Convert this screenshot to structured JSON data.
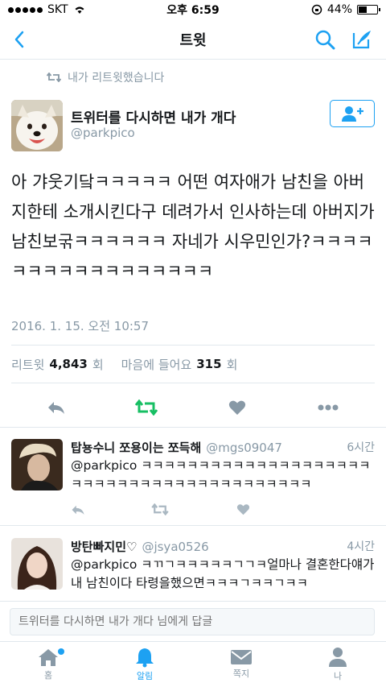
{
  "status_bar": {
    "carrier": "SKT",
    "time": "오후 6:59",
    "battery": "44%"
  },
  "nav": {
    "title": "트윗"
  },
  "retweet_notice": "내가 리트윗했습니다",
  "tweet": {
    "author_name": "트위터를 다시하면 내가 개다",
    "author_handle": "@parkpico",
    "text": "아 갸웃기닼ㅋㅋㅋㅋㅋ 어떤 여자애가 남친을 아버지한테 소개시킨다구 데려가서 인사하는데 아버지가 남친보굮ㅋㅋㅋㅋㅋㅋ 자네가 시우민인가?ㅋㅋㅋㅋㅋㅋㅋㅋㅋㅋㅋㅋㅋㅋㅋㅋㅋ",
    "timestamp": "2016. 1. 15. 오전 10:57",
    "retweets_label": "리트윗",
    "retweets_count": "4,843",
    "likes_label": "마음에 들어요",
    "likes_count": "315",
    "count_unit": "회"
  },
  "replies": [
    {
      "name": "탑뇽수니 쪼용이는 쪼득해",
      "handle": "@mgs09047",
      "time": "6시간",
      "text": "@parkpico ㅋㅋㅋㅋㅋㅋㅋㅋㅋㅋㅋㅋㅋㅋㅋㅋㅋㅋㅋㅋㅋㅋㅋㅋㅋㅋㅋㅋㅋㅋㅋㅋㅋㅋㅋㅋㅋㅋㅋㅋㅋ"
    },
    {
      "name": "방탄빠지민♡",
      "handle": "@jsya0526",
      "time": "4시간",
      "text": "@parkpico ㅋㄲㄱㅋㅋㅋㅋㅋㄱㄱㅋ얼마나 결혼한다얘가 내 남친이다 타령을했으면ㅋㅋㅋㄱㅋㅋㄱㅋㅋ"
    }
  ],
  "reply_box": {
    "placeholder": "트위터를 다시하면 내가 개다 님에게 답글"
  },
  "tabs": [
    {
      "label": "홈",
      "icon": "home-icon"
    },
    {
      "label": "알림",
      "icon": "bell-icon"
    },
    {
      "label": "쪽지",
      "icon": "envelope-icon"
    },
    {
      "label": "나",
      "icon": "person-icon"
    }
  ],
  "colors": {
    "accent": "#1da1f2",
    "retweet_green": "#17bf63",
    "muted": "#8899a6"
  }
}
